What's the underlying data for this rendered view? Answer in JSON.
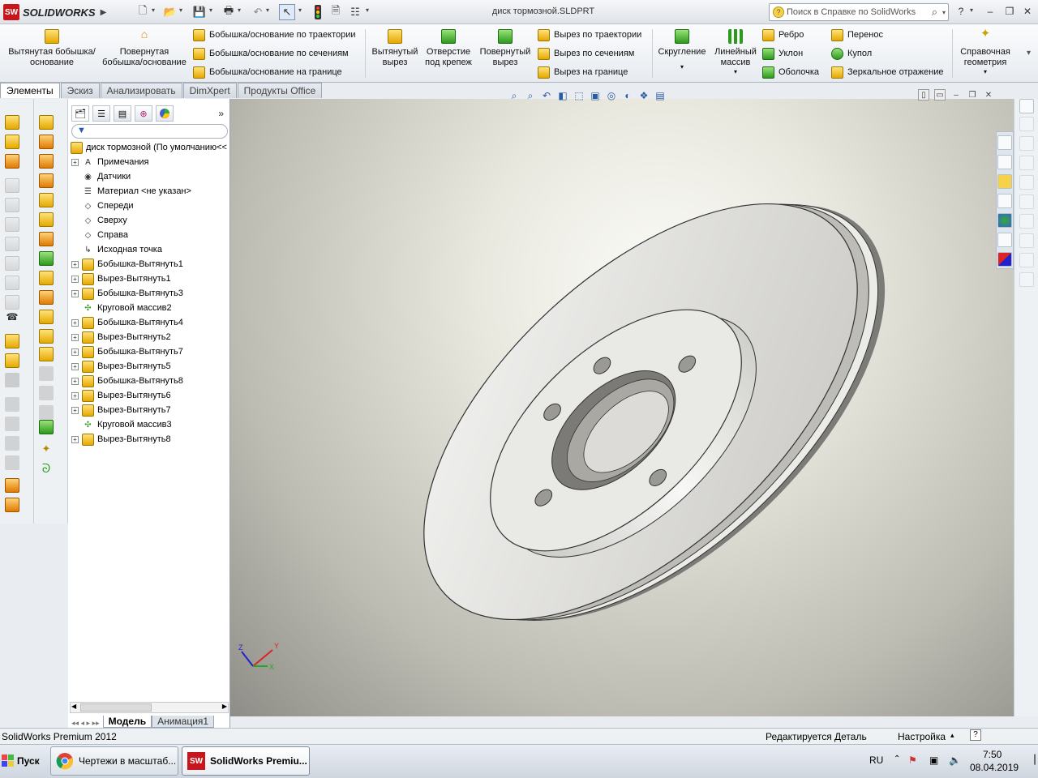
{
  "app": {
    "title": "SOLIDWORKS",
    "document_title": "диск тормозной.SLDPRT"
  },
  "help_search": {
    "placeholder": "Поиск в Справке по SolidWorks"
  },
  "command_manager": {
    "big_buttons": [
      {
        "label": "Вытянутая бобышка/основание"
      },
      {
        "label": "Повернутая бобышка/основание"
      },
      {
        "label": "Вытянутый вырез"
      },
      {
        "label": "Отверстие под крепеж"
      },
      {
        "label": "Повернутый вырез"
      },
      {
        "label": "Скругление"
      },
      {
        "label": "Линейный массив"
      },
      {
        "label": "Справочная геометрия"
      }
    ],
    "small_buttons": [
      {
        "label": "Бобышка/основание по траектории"
      },
      {
        "label": "Бобышка/основание по сечениям"
      },
      {
        "label": "Бобышка/основание на границе"
      },
      {
        "label": "Вырез по траектории"
      },
      {
        "label": "Вырез по сечениям"
      },
      {
        "label": "Вырез на границе"
      },
      {
        "label": "Ребро"
      },
      {
        "label": "Уклон"
      },
      {
        "label": "Оболочка"
      },
      {
        "label": "Перенос"
      },
      {
        "label": "Купол"
      },
      {
        "label": "Зеркальное отражение"
      }
    ]
  },
  "tabs": [
    "Элементы",
    "Эскиз",
    "Анализировать",
    "DimXpert",
    "Продукты Office"
  ],
  "feature_tree": {
    "root": "диск тормозной  (По умолчанию<<",
    "items": [
      {
        "label": "Примечания",
        "expandable": true
      },
      {
        "label": "Датчики",
        "expandable": false
      },
      {
        "label": "Материал <не указан>",
        "expandable": false
      },
      {
        "label": "Спереди",
        "expandable": false
      },
      {
        "label": "Сверху",
        "expandable": false
      },
      {
        "label": "Справа",
        "expandable": false
      },
      {
        "label": "Исходная точка",
        "expandable": false
      },
      {
        "label": "Бобышка-Вытянуть1",
        "expandable": true
      },
      {
        "label": "Вырез-Вытянуть1",
        "expandable": true
      },
      {
        "label": "Бобышка-Вытянуть3",
        "expandable": true
      },
      {
        "label": "Круговой массив2",
        "expandable": false
      },
      {
        "label": "Бобышка-Вытянуть4",
        "expandable": true
      },
      {
        "label": "Вырез-Вытянуть2",
        "expandable": true
      },
      {
        "label": "Бобышка-Вытянуть7",
        "expandable": true
      },
      {
        "label": "Вырез-Вытянуть5",
        "expandable": true
      },
      {
        "label": "Бобышка-Вытянуть8",
        "expandable": true
      },
      {
        "label": "Вырез-Вытянуть6",
        "expandable": true
      },
      {
        "label": "Вырез-Вытянуть7",
        "expandable": true
      },
      {
        "label": "Круговой массив3",
        "expandable": false
      },
      {
        "label": "Вырез-Вытянуть8",
        "expandable": true
      }
    ]
  },
  "bottom_tabs": [
    "Модель",
    "Анимация1"
  ],
  "status": {
    "product": "SolidWorks Premium 2012",
    "editing": "Редактируется Деталь",
    "units": "Настройка"
  },
  "taskbar": {
    "start": "Пуск",
    "items": [
      {
        "label": "Чертежи в масштаб..."
      },
      {
        "label": "SolidWorks Premiu..."
      }
    ],
    "lang": "RU",
    "time": "7:50",
    "date": "08.04.2019"
  }
}
